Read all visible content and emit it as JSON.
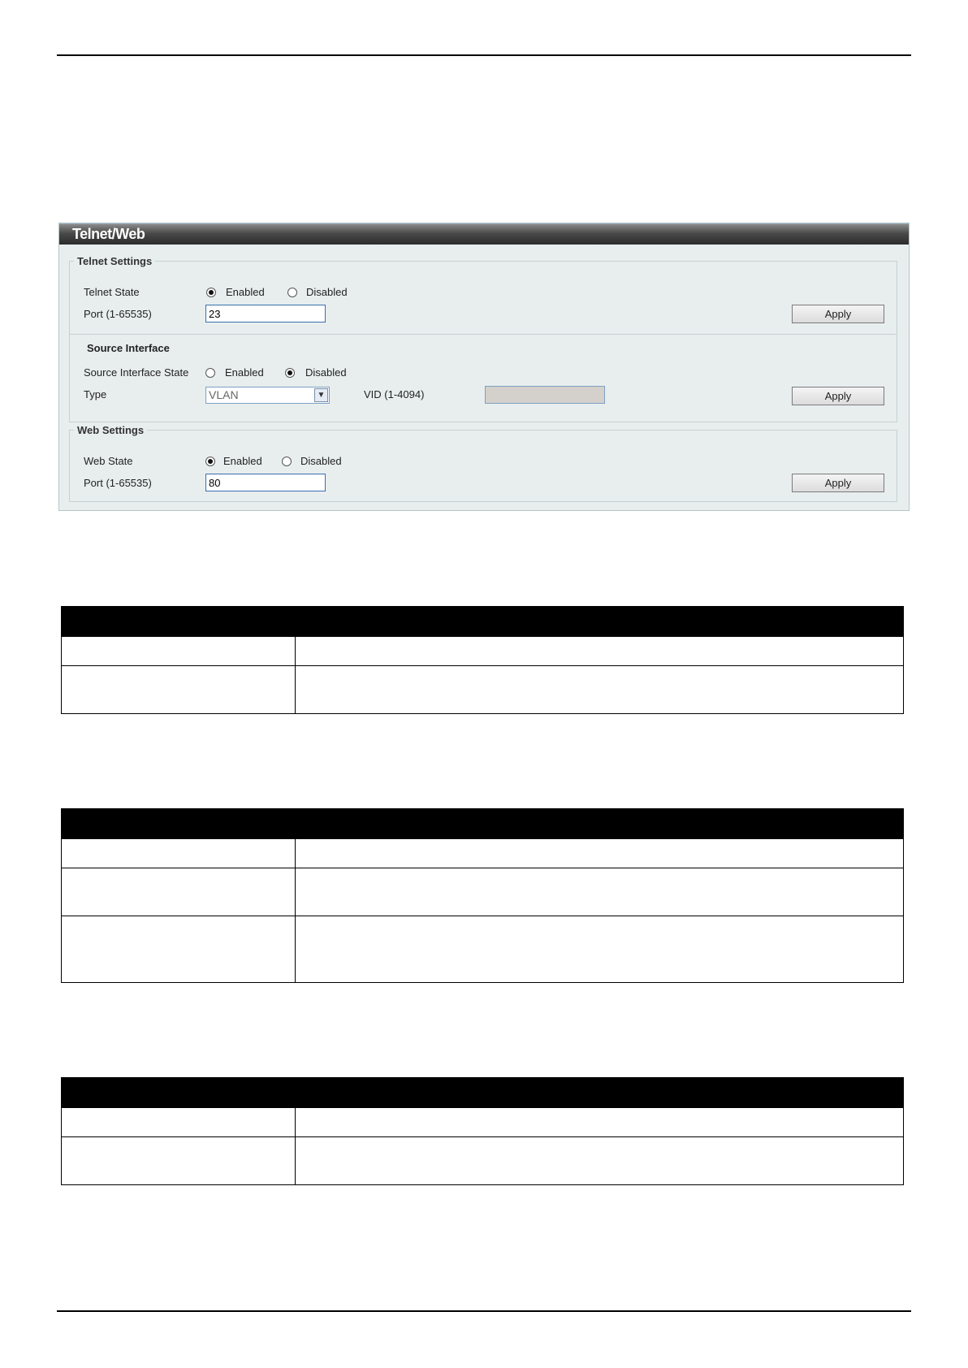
{
  "panel": {
    "title": "Telnet/Web",
    "telnet": {
      "legend": "Telnet Settings",
      "state_label": "Telnet State",
      "enabled_label": "Enabled",
      "disabled_label": "Disabled",
      "state": "Enabled",
      "port_label": "Port (1-65535)",
      "port_value": "23",
      "apply_label": "Apply"
    },
    "source_interface": {
      "heading": "Source Interface",
      "state_label": "Source Interface State",
      "enabled_label": "Enabled",
      "disabled_label": "Disabled",
      "state": "Disabled",
      "type_label": "Type",
      "type_value": "VLAN",
      "vid_label": "VID (1-4094)",
      "vid_value": "",
      "apply_label": "Apply"
    },
    "web": {
      "legend": "Web Settings",
      "state_label": "Web State",
      "enabled_label": "Enabled",
      "disabled_label": "Disabled",
      "state": "Enabled",
      "port_label": "Port (1-65535)",
      "port_value": "80",
      "apply_label": "Apply"
    }
  },
  "tables": [
    {
      "header": [
        "",
        ""
      ],
      "rows": [
        [
          "",
          ""
        ],
        [
          "",
          ""
        ]
      ]
    },
    {
      "header": [
        "",
        ""
      ],
      "rows": [
        [
          "",
          ""
        ],
        [
          "",
          ""
        ],
        [
          "",
          ""
        ]
      ]
    },
    {
      "header": [
        "",
        ""
      ],
      "rows": [
        [
          "",
          ""
        ],
        [
          "",
          ""
        ]
      ]
    }
  ]
}
